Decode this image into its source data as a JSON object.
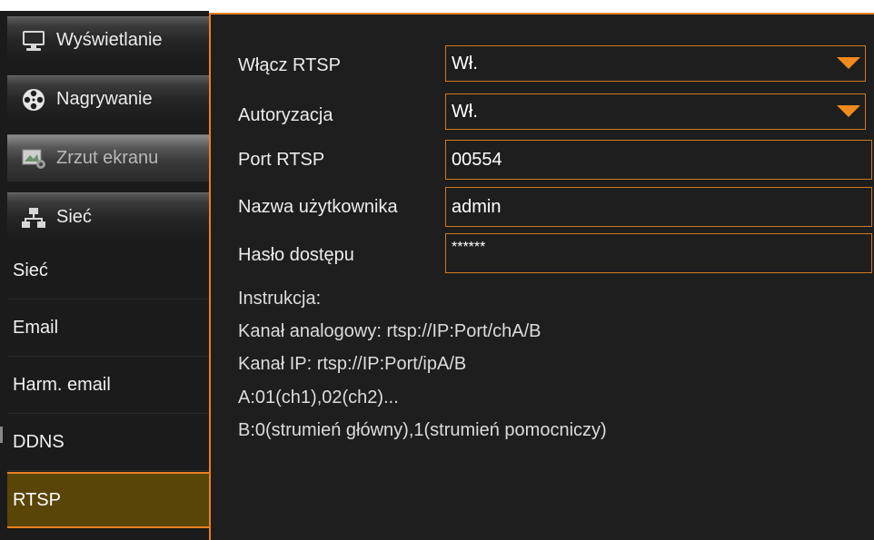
{
  "sidebar": {
    "categories": [
      {
        "label": "Wyświetlanie",
        "icon": "monitor-icon"
      },
      {
        "label": "Nagrywanie",
        "icon": "film-reel-icon"
      },
      {
        "label": "Zrzut ekranu",
        "icon": "snapshot-icon"
      },
      {
        "label": "Sieć",
        "icon": "network-icon"
      }
    ],
    "subitems": [
      {
        "label": "Sieć"
      },
      {
        "label": "Email"
      },
      {
        "label": "Harm. email"
      },
      {
        "label": "DDNS"
      },
      {
        "label": "RTSP"
      }
    ],
    "active_subitem": "RTSP"
  },
  "form": {
    "enable_rtsp": {
      "label": "Włącz RTSP",
      "value": "Wł."
    },
    "authorization": {
      "label": "Autoryzacja",
      "value": "Wł."
    },
    "port": {
      "label": "Port RTSP",
      "value": "00554"
    },
    "username": {
      "label": "Nazwa użytkownika",
      "value": "admin"
    },
    "password": {
      "label": "Hasło dostępu",
      "value": "******"
    }
  },
  "instructions": {
    "heading": "Instrukcja:",
    "lines": [
      "Kanał analogowy:  rtsp://IP:Port/chA/B",
      "Kanał IP:  rtsp://IP:Port/ipA/B",
      "A:01(ch1),02(ch2)...",
      "B:0(strumień główny),1(strumień pomocniczy)"
    ]
  },
  "colors": {
    "accent": "#e8801e",
    "background": "#1e1e1e",
    "active_item": "#5a4508"
  }
}
